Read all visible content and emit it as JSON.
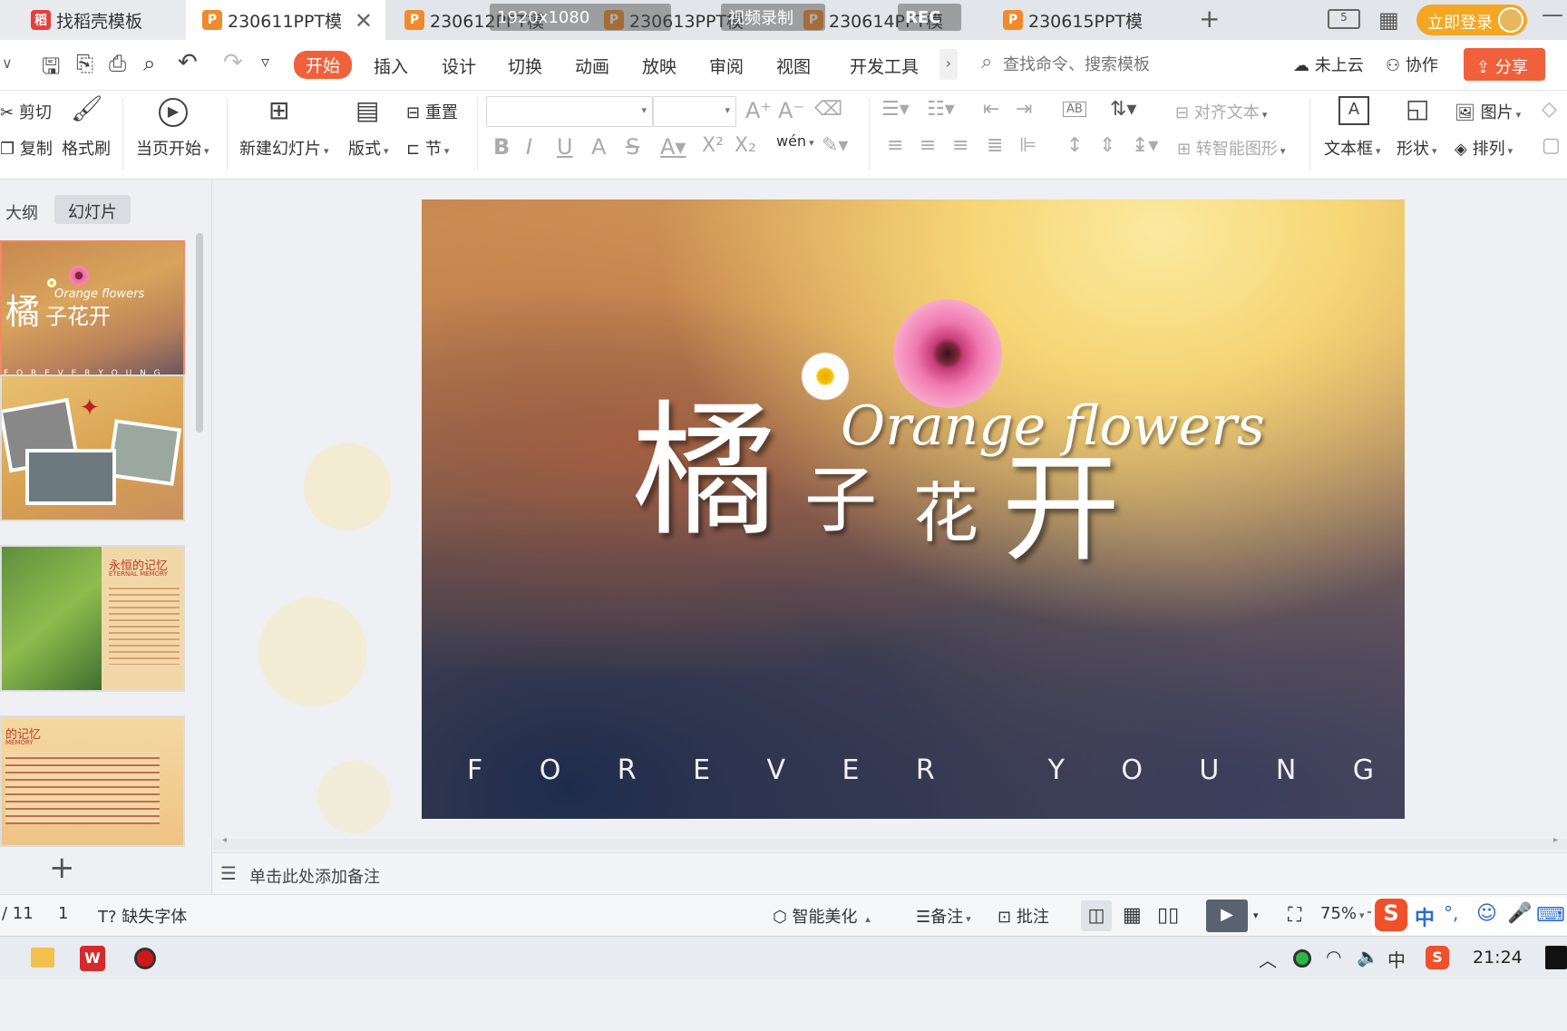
{
  "tabs": [
    {
      "label": "找稻壳模板",
      "icon": "daoke-icon"
    },
    {
      "label": "230611PPT模",
      "icon": "ppt-icon"
    },
    {
      "label": "230612PPT模",
      "icon": "ppt-icon"
    },
    {
      "label": "230613PPT模",
      "icon": "ppt-icon"
    },
    {
      "label": "230614PPT模",
      "icon": "ppt-icon"
    },
    {
      "label": "230615PPT模",
      "icon": "ppt-icon"
    }
  ],
  "overlay": {
    "resolution": "1920x1080",
    "record": "视频录制",
    "rec": "REC"
  },
  "header": {
    "login": "立即登录"
  },
  "menu": [
    "开始",
    "插入",
    "设计",
    "切换",
    "动画",
    "放映",
    "审阅",
    "视图",
    "开发工具"
  ],
  "search": {
    "placeholder": "查找命令、搜索模板"
  },
  "menu_right": {
    "cloud": "未上云",
    "collab": "协作",
    "share": "分享"
  },
  "ribbon": {
    "cut": "剪切",
    "copy": "复制",
    "format_brush": "格式刷",
    "play_from": "当页开始",
    "new_slide": "新建幻灯片",
    "layout": "版式",
    "reset": "重置",
    "section": "节",
    "align_text": "对齐文本",
    "smart_shape": "转智能图形",
    "textbox": "文本框",
    "shape": "形状",
    "picture": "图片",
    "arrange": "排列",
    "ab": "AB",
    "wen": "wén"
  },
  "panel": {
    "outline_tab": "大纲",
    "slides_tab": "幻灯片",
    "add": "+"
  },
  "thumb1": {
    "title1": "橘",
    "title2": "子花开",
    "eng": "Orange flowers",
    "sub": "F O R E V E R   Y O U N G"
  },
  "thumb3": {
    "title": "永恒的记忆",
    "eng": "ETERNAL MEMORY"
  },
  "thumb4": {
    "title": "的记忆",
    "eng": "MEMORY"
  },
  "slide": {
    "char1": "橘",
    "char2": "子",
    "char3": "花",
    "char4": "开",
    "eng": "Orange flowers",
    "tagline": [
      "F",
      "O",
      "R",
      "E",
      "V",
      "E",
      "R",
      "",
      "Y",
      "O",
      "U",
      "N",
      "G"
    ]
  },
  "notes": {
    "placeholder": "单击此处添加备注"
  },
  "status": {
    "page": "/ 11",
    "num": "1",
    "missing_font": "缺失字体",
    "beautify": "智能美化",
    "notes": "备注",
    "comment": "批注",
    "zoom": "75%"
  },
  "ime": {
    "zh": "中",
    "punct": "°,"
  },
  "tray": {
    "lang": "中",
    "time": "21:24"
  },
  "colors": {
    "accent": "#f0603a",
    "login": "#f5a623",
    "share": "#f0603a"
  }
}
